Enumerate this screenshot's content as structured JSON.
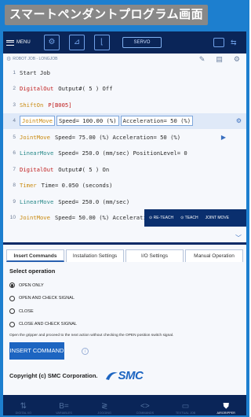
{
  "caption": "スマートペンダントプログラム画面",
  "topbar": {
    "menu_label": "MENU",
    "servo_label": "SERVO"
  },
  "editor": {
    "file_path": "ROBOT JOB - LONGJOB",
    "lines": [
      {
        "num": "1",
        "cmd": "Start Job",
        "args": ""
      },
      {
        "num": "2",
        "cmd": "DigitalOut",
        "args": "Output#( 5 )  Off"
      },
      {
        "num": "3",
        "cmd": "ShiftOn",
        "args": "P[B005]"
      },
      {
        "num": "4",
        "cmd": "JointMove",
        "args_a": "Speed= 100.00 (%)",
        "args_b": "Acceleration= 50 (%)"
      },
      {
        "num": "5",
        "cmd": "JointMove",
        "args": "Speed= 75.00 (%)  Acceleration= 50 (%)"
      },
      {
        "num": "6",
        "cmd": "LinearMove",
        "args": "Speed= 250.0 (mm/sec)  PositionLevel= 0"
      },
      {
        "num": "7",
        "cmd": "DigitalOut",
        "args": "Output#( 5 )  On"
      },
      {
        "num": "8",
        "cmd": "Timer",
        "args": "Time= 0.050 (seconds)"
      },
      {
        "num": "9",
        "cmd": "LinearMove",
        "args": "Speed= 250.0 (mm/sec)"
      },
      {
        "num": "10",
        "cmd": "JointMove",
        "args": "Speed= 50.00 (%)  Acceleration= B000(%)"
      }
    ],
    "teach_bar": {
      "reteach": "RE-TEACH",
      "teach": "TEACH",
      "joint_move": "JOINT MOVE"
    }
  },
  "panel": {
    "tabs": [
      "Insert Commands",
      "Installation Settings",
      "I/O Settings",
      "Manual Operation"
    ],
    "select_title": "Select operation",
    "options": [
      "OPEN ONLY",
      "OPEN AND CHECK SIGNAL",
      "CLOSE",
      "CLOSE AND CHECK SIGNAL"
    ],
    "description": "Open the gripper and proceed to the next action without checking the OPEN position switch signal.",
    "insert_button": "INSERT COMMAND",
    "copyright": "Copyright (c) SMC Corporation.",
    "logo_text": "SMC"
  },
  "bottom_nav": [
    "DIGITAL I/O",
    "VARIABLES",
    "JOGGING",
    "COMMANDS",
    "TEXTUAL JOB",
    "AIRGRIPPER"
  ],
  "colors": {
    "accent": "#1d65c1",
    "frame": "#1d7fcf",
    "navbar": "#0a2558"
  }
}
